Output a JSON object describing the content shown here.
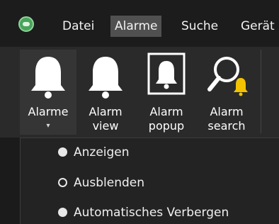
{
  "menubar": {
    "items": [
      {
        "label": "Datei",
        "active": false
      },
      {
        "label": "Alarme",
        "active": true
      },
      {
        "label": "Suche",
        "active": false
      },
      {
        "label": "Gerät",
        "active": false
      }
    ],
    "logo_icon": "app-logo-icon"
  },
  "ribbon": {
    "buttons": [
      {
        "label": "Alarme",
        "icon": "bell-icon",
        "has_dropdown": true,
        "dropdown_glyph": "▾"
      },
      {
        "label": "Alarm view",
        "line1": "Alarm",
        "line2": "view",
        "icon": "bell-icon"
      },
      {
        "label": "Alarm popup",
        "line1": "Alarm",
        "line2": "popup",
        "icon": "bell-popup-icon"
      },
      {
        "label": "Alarm search",
        "line1": "Alarm",
        "line2": "search",
        "icon": "search-bell-icon"
      }
    ]
  },
  "popup": {
    "options": [
      {
        "label": "Anzeigen",
        "selected": false
      },
      {
        "label": "Ausblenden",
        "selected": true
      },
      {
        "label": "Automatisches Verbergen",
        "selected": false
      }
    ]
  },
  "colors": {
    "background": "#1e1e1e",
    "menu_active": "#505050",
    "bell_accent": "#f2c200",
    "logo": "#4aa35a"
  }
}
